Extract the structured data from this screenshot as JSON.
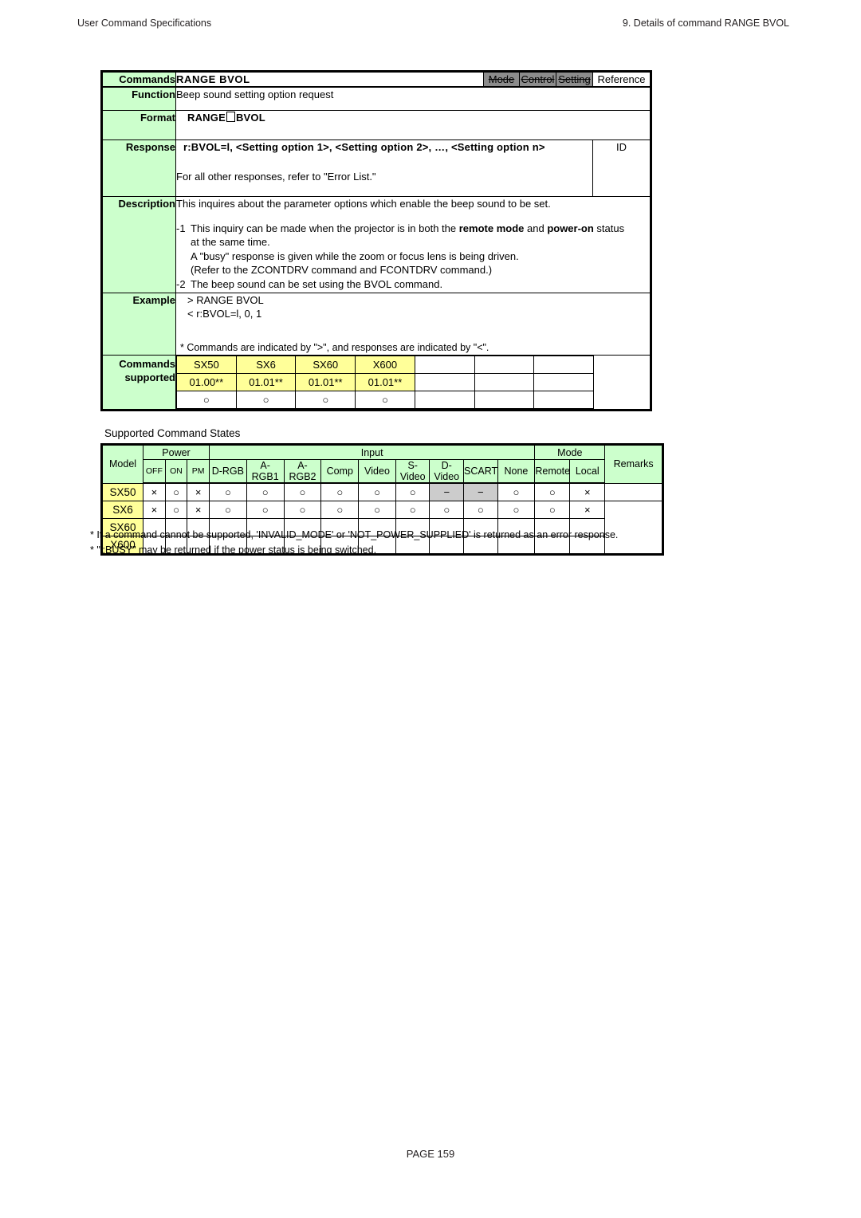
{
  "runhead": {
    "left": "User Command Specifications",
    "right": "9. Details of command  RANGE BVOL"
  },
  "command": {
    "label_commands": "Commands",
    "title": "RANGE BVOL",
    "flags": [
      {
        "label": "Mode",
        "struck": true
      },
      {
        "label": "Control",
        "struck": true
      },
      {
        "label": "Setting",
        "struck": true
      }
    ],
    "reference_label": "Reference",
    "label_function": "Function",
    "function_text": "Beep sound setting option request",
    "label_format": "Format",
    "format_prefix": "RANGE",
    "format_suffix": "BVOL",
    "label_response": "Response",
    "response_line1": "r:BVOL=l, <Setting option 1>, <Setting option 2>, …, <Setting option n>",
    "response_line2": "For all other responses, refer to \"Error List.\"",
    "response_id": "ID",
    "label_description": "Description",
    "description_intro": "This inquires about the parameter options which enable the beep sound to be set.",
    "description_items": [
      {
        "num": "-1",
        "lines": [
          "This inquiry can be made when the projector is in both the remote mode and power-on status",
          "at the same time.",
          "A \"busy\" response is given while the zoom or focus lens is being driven.",
          "(Refer to the ZCONTDRV command and FCONTDRV command.)"
        ],
        "bold_terms": [
          "remote mode",
          "power-on"
        ]
      },
      {
        "num": "-2",
        "lines": [
          "The beep sound can be set using the BVOL command."
        ],
        "bold_terms": []
      }
    ],
    "label_example": "Example",
    "example_lines": [
      "> RANGE BVOL",
      "< r:BVOL=l, 0, 1"
    ],
    "example_note": "* Commands are indicated by \">\", and responses are indicated by \"<\".",
    "label_supported_line1": "Commands",
    "label_supported_line2": "supported",
    "supported_models": [
      "SX50",
      "SX6",
      "SX60",
      "X600",
      "",
      "",
      ""
    ],
    "supported_versions": [
      "01.00**",
      "01.01**",
      "01.01**",
      "01.01**",
      "",
      "",
      ""
    ],
    "supported_marks": [
      "○",
      "○",
      "○",
      "○",
      "",
      "",
      ""
    ]
  },
  "states": {
    "title": "Supported Command States",
    "group_headers": {
      "model": "Model",
      "power": "Power",
      "input": "Input",
      "mode": "Mode",
      "remarks": "Remarks"
    },
    "sub_headers": {
      "power": [
        "OFF",
        "ON",
        "PM"
      ],
      "input": [
        "D-RGB",
        "A-RGB1",
        "A-RGB2",
        "Comp",
        "Video",
        "S-Video",
        "D-Video",
        "SCART",
        "None"
      ],
      "mode": [
        "Remote",
        "Local"
      ]
    },
    "rows": [
      {
        "model_lines": [
          "SX50"
        ],
        "cells": [
          "×",
          "○",
          "×",
          "○",
          "○",
          "○",
          "○",
          "○",
          "○",
          "−",
          "−",
          "○",
          "○",
          "×"
        ],
        "dash_indices": [
          9,
          10
        ],
        "remarks": ""
      },
      {
        "model_lines": [
          "SX6",
          "SX60",
          "X600"
        ],
        "cells": [
          "×",
          "○",
          "×",
          "○",
          "○",
          "○",
          "○",
          "○",
          "○",
          "○",
          "○",
          "○",
          "○",
          "×"
        ],
        "dash_indices": [],
        "remarks": ""
      }
    ]
  },
  "footnotes": [
    "* If a command cannot be supported, 'INVALID_MODE' or 'NOT_POWER_SUPPLIED' is returned as an error response.",
    "* \"i:BUSY\" may be returned if the power status is being switched."
  ],
  "page_number": "PAGE  159",
  "colors": {
    "label_green": "#ccffcc",
    "model_yellow": "#ffff99",
    "flag_gray": "#8c8c8c",
    "dash_gray": "#cccccc"
  }
}
